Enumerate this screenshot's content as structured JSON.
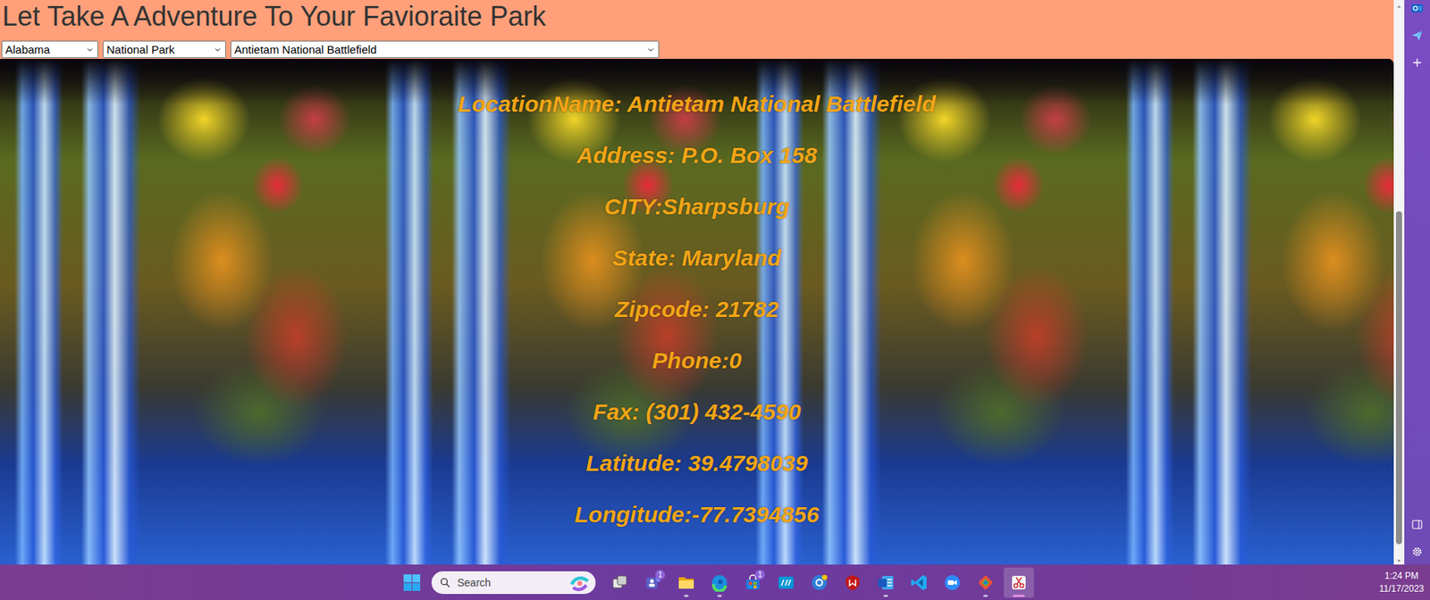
{
  "page": {
    "title": "Let Take A Adventure To Your Favioraite Park"
  },
  "filters": [
    {
      "value": "Alabama"
    },
    {
      "value": "National Park"
    },
    {
      "value": "Antietam National Battlefield"
    }
  ],
  "park_info": [
    "LocationName: Antietam National Battlefield",
    "Address: P.O. Box 158",
    "CITY:Sharpsburg",
    "State: Maryland",
    "Zipcode: 21782",
    "Phone:0",
    "Fax: (301) 432-4590",
    "Latitude: 39.4798039",
    "Longitude:-77.7394856"
  ],
  "scrollbar": {
    "level": 0.6
  },
  "taskbar": {
    "search": {
      "placeholder": "Search"
    },
    "apps": [
      {
        "kind": "taskview",
        "running": false,
        "active": false
      },
      {
        "kind": "teams",
        "running": false,
        "active": false,
        "badge": "1"
      },
      {
        "kind": "explorer",
        "running": true,
        "active": false
      },
      {
        "kind": "edge",
        "running": true,
        "active": false
      },
      {
        "kind": "store",
        "running": false,
        "active": false,
        "badge": "1"
      },
      {
        "kind": "hp",
        "running": false,
        "active": false
      },
      {
        "kind": "help",
        "running": false,
        "active": false
      },
      {
        "kind": "mcafee",
        "running": false,
        "active": false
      },
      {
        "kind": "word",
        "running": true,
        "active": false
      },
      {
        "kind": "vscode",
        "running": false,
        "active": false
      },
      {
        "kind": "zoom",
        "running": false,
        "active": false
      },
      {
        "kind": "git",
        "running": true,
        "active": false
      },
      {
        "kind": "snip",
        "running": true,
        "active": true
      }
    ],
    "clock": {
      "time": "1:24 PM",
      "date": "11/17/2023"
    }
  }
}
